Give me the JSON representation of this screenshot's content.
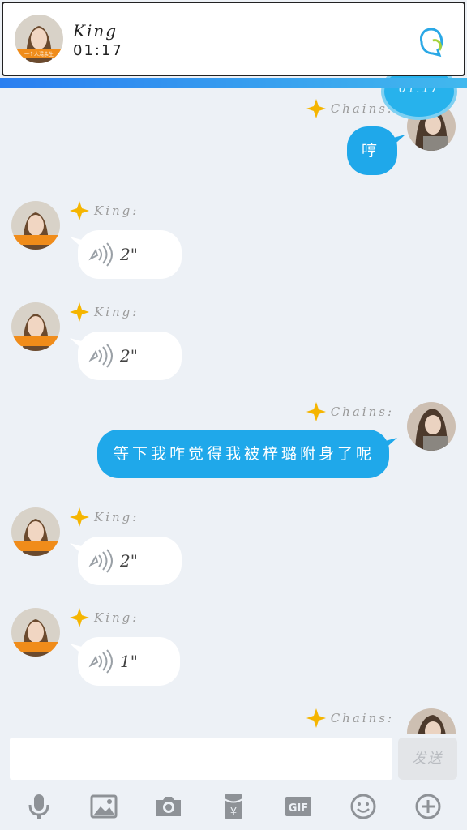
{
  "header": {
    "name": "King",
    "time": "01:17"
  },
  "floating_time": "01:17",
  "messages": [
    {
      "side": "right",
      "sender": "Chains:",
      "type": "text",
      "text": "哼"
    },
    {
      "side": "left",
      "sender": "King:",
      "type": "voice",
      "duration": "2\""
    },
    {
      "side": "left",
      "sender": "King:",
      "type": "voice",
      "duration": "2\""
    },
    {
      "side": "right",
      "sender": "Chains:",
      "type": "text",
      "text": "等下我咋觉得我被梓璐附身了呢"
    },
    {
      "side": "left",
      "sender": "King:",
      "type": "voice",
      "duration": "2\""
    },
    {
      "side": "left",
      "sender": "King:",
      "type": "voice",
      "duration": "1\""
    },
    {
      "side": "right",
      "sender": "Chains:",
      "type": "partial",
      "text": ""
    }
  ],
  "avatar_label": "一个人混余生",
  "input": {
    "placeholder": "",
    "send_label": "发送"
  },
  "toolbar": [
    "microphone-icon",
    "image-icon",
    "camera-icon",
    "red-packet-icon",
    "gif-icon",
    "emoji-icon",
    "plus-icon"
  ],
  "colors": {
    "accent": "#1fa8ea",
    "background": "#edf1f6",
    "star": "#f5b500"
  }
}
